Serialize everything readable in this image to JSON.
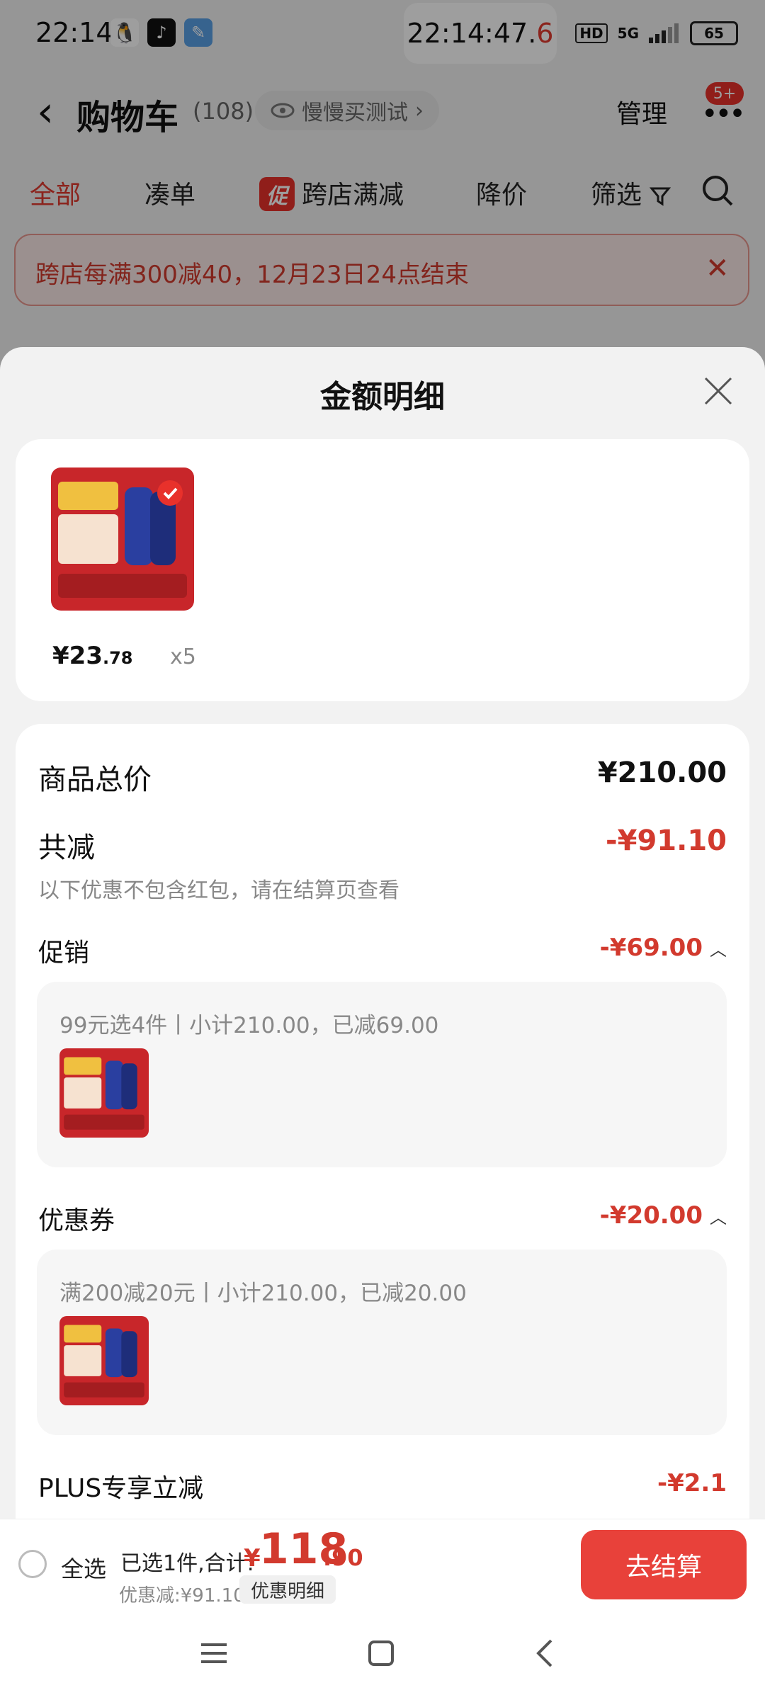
{
  "status_bar": {
    "time": "22:14",
    "clock_main": "22:14:47.",
    "clock_last": "6",
    "network": "5G",
    "hd": "HD",
    "battery": "65"
  },
  "header": {
    "title": "购物车",
    "count": "(108)",
    "slow_buy": "慢慢买测试",
    "manage": "管理",
    "badge": "5+"
  },
  "filters": {
    "all": "全部",
    "bundle": "凑单",
    "promo_tag": "促",
    "cross_store": "跨店满减",
    "price_drop": "降价",
    "filter": "筛选"
  },
  "notice": {
    "text": "跨店每满300减40，12月23日24点结束"
  },
  "sheet": {
    "title": "金额明细",
    "product": {
      "price_main": "¥23",
      "price_dec": ".78",
      "qty": "x5"
    },
    "total_label": "商品总价",
    "total_value": "¥210.00",
    "reduce_label": "共减",
    "reduce_value": "-¥91.10",
    "note": "以下优惠不包含红包，请在结算页查看",
    "promo": {
      "label": "促销",
      "value": "-¥69.00",
      "detail": "99元选4件丨小计210.00，已减69.00"
    },
    "coupon": {
      "label": "优惠券",
      "value": "-¥20.00",
      "detail": "满200减20元丨小计210.00，已减20.00"
    },
    "plus": {
      "label": "PLUS专享立减",
      "value": "-¥2.1"
    }
  },
  "bottom_bar": {
    "select_all": "全选",
    "selected": "已选1件,合计:",
    "currency": "¥",
    "total_int": "118",
    "total_dec": ".90",
    "discount": "优惠减:¥91.10",
    "detail_button": "优惠明细",
    "checkout": "去结算"
  },
  "colors": {
    "accent": "#e03a2f",
    "checkout": "#e8413a"
  }
}
